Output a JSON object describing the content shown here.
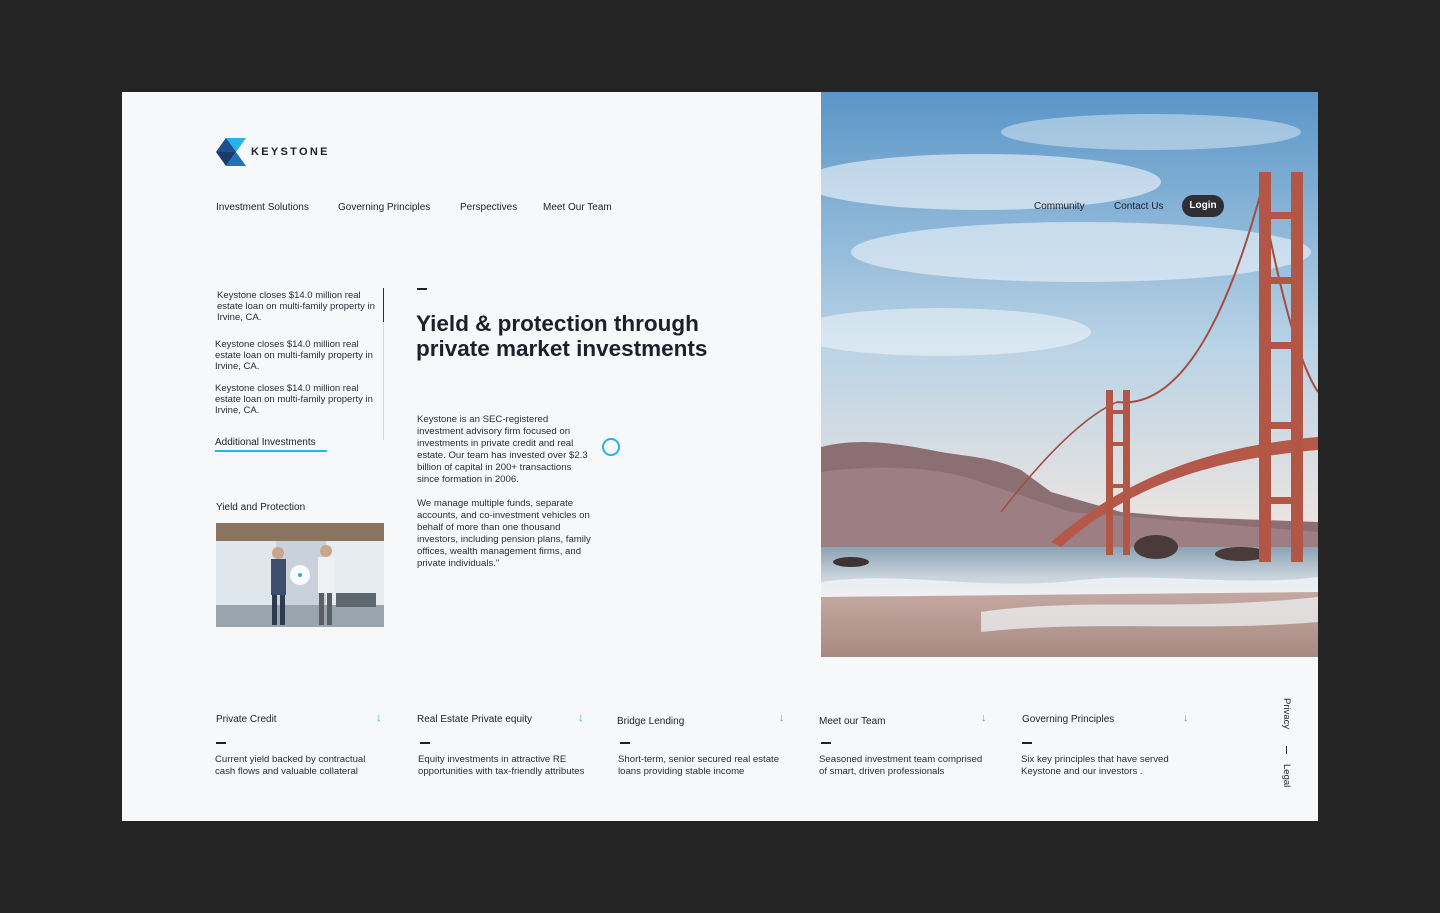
{
  "brand": {
    "name": "KEYSTONE",
    "colors": {
      "blue": "#29b2e6",
      "navy": "#1b3a6b",
      "dark": "#1d1f2a"
    }
  },
  "nav": {
    "items": [
      "Investment Solutions",
      "Governing Principles",
      "Perspectives",
      "Meet Our Team"
    ],
    "right": [
      "Community",
      "Contact Us"
    ],
    "login": "Login"
  },
  "news": {
    "items": [
      "Keystone closes $14.0 million real estate loan on multi-family property in Irvine, CA.",
      "Keystone closes $14.0 million real estate loan on multi-family property in Irvine, CA.",
      "Keystone closes $14.0 million real estate loan on multi-family property in Irvine, CA."
    ],
    "more_link": "Additional Investments"
  },
  "video": {
    "title": "Yield and Protection"
  },
  "hero": {
    "headline": "Yield & protection through private market investments",
    "para1": "Keystone is an SEC-registered investment advisory firm focused on investments in private credit and real estate.  Our team has invested over $2.3 billion of capital in 200+ transactions since formation in 2006.",
    "para2": "We manage multiple funds, separate accounts, and co-investment vehicles on behalf of more than one thousand investors, including pension plans, family offices, wealth management firms, and private individuals.\""
  },
  "features": [
    {
      "title": "Private Credit",
      "desc": "Current yield backed by contractual cash flows and valuable collateral"
    },
    {
      "title": "Real Estate Private equity",
      "desc": "Equity investments in attractive RE opportunities with tax-friendly attributes"
    },
    {
      "title": "Bridge Lending",
      "desc": "Short-term, senior secured real estate loans providing stable income"
    },
    {
      "title": "Meet our Team",
      "desc": "Seasoned investment team comprised of smart, driven professionals"
    },
    {
      "title": "Governing Principles",
      "desc": "Six key principles that have served Keystone and our investors ."
    }
  ],
  "footer": {
    "privacy": "Privacy",
    "legal": "Legal"
  },
  "icons": {
    "feature_arrow": "↓"
  }
}
